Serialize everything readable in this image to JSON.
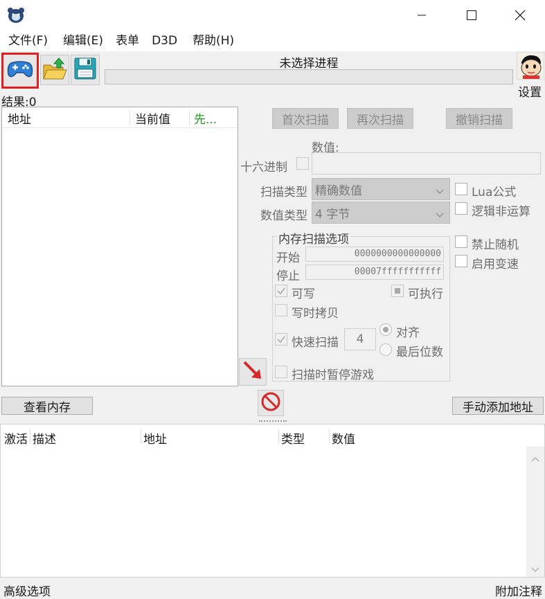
{
  "menu": [
    "文件(F)",
    "编辑(E)",
    "表单",
    "D3D",
    "帮助(H)"
  ],
  "process_label": "未选择进程",
  "settings_label": "设置",
  "results_label": "结果:0",
  "results_columns": [
    "地址",
    "当前值",
    "先..."
  ],
  "buttons": {
    "first_scan": "首次扫描",
    "next_scan": "再次扫描",
    "undo_scan": "撤销扫描",
    "view_memory": "查看内存",
    "add_address": "手动添加地址"
  },
  "value_label": "数值:",
  "hex_label": "十六进制",
  "scan_type_label": "扫描类型",
  "scan_type_value": "精确数值",
  "value_type_label": "数值类型",
  "value_type_value": "4 字节",
  "lua_label": "Lua公式",
  "not_logic_label": "逻辑非运算",
  "disable_random_label": "禁止随机",
  "speedhack_label": "启用变速",
  "mem_options_label": "内存扫描选项",
  "start_label": "开始",
  "start_value": "0000000000000000",
  "stop_label": "停止",
  "stop_value": "00007fffffffffff",
  "writable_label": "可写",
  "executable_label": "可执行",
  "copy_on_write_label": "写时拷贝",
  "fast_scan_label": "快速扫描",
  "fast_scan_value": "4",
  "align_label": "对齐",
  "last_digits_label": "最后位数",
  "pause_game_label": "扫描时暂停游戏",
  "address_columns": [
    "激活",
    "描述",
    "地址",
    "类型",
    "数值"
  ],
  "status_left": "高级选项",
  "status_right": "附加注释",
  "colors": {
    "accent_red": "#e02020",
    "green_text": "#1f9a1f"
  }
}
